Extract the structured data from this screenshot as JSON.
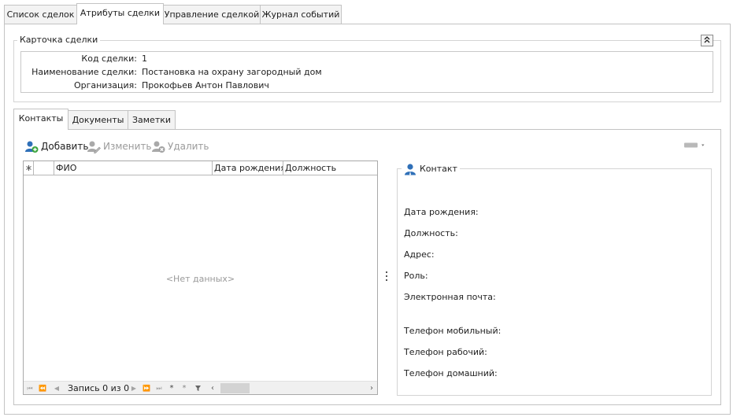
{
  "top_tabs": [
    "Список сделок",
    "Атрибуты сделки",
    "Управление сделкой",
    "Журнал событий"
  ],
  "deal_card": {
    "title": "Карточка сделки",
    "fields": [
      {
        "label": "Код сделки:",
        "value": "1"
      },
      {
        "label": "Наименование сделки:",
        "value": "Постановка на охрану загородный дом"
      },
      {
        "label": "Организация:",
        "value": "Прокофьев Антон Павлович"
      }
    ]
  },
  "sub_tabs": [
    "Контакты",
    "Документы",
    "Заметки"
  ],
  "toolbar": {
    "add_label": "Добавить",
    "edit_label": "Изменить",
    "delete_label": "Удалить"
  },
  "grid": {
    "columns": [
      "ФИО",
      "Дата рождения",
      "Должность"
    ],
    "empty_text": "<Нет данных>",
    "nav_label": "Запись 0 из 0"
  },
  "contact": {
    "title": "Контакт",
    "fields": [
      "Дата рождения:",
      "Должность:",
      "Адрес:",
      "Роль:",
      "Электронная почта:",
      "Телефон мобильный:",
      "Телефон рабочий:",
      "Телефон домашний:"
    ]
  },
  "colors": {
    "accent": "#2a6ebb",
    "border": "#c3c3c3"
  }
}
